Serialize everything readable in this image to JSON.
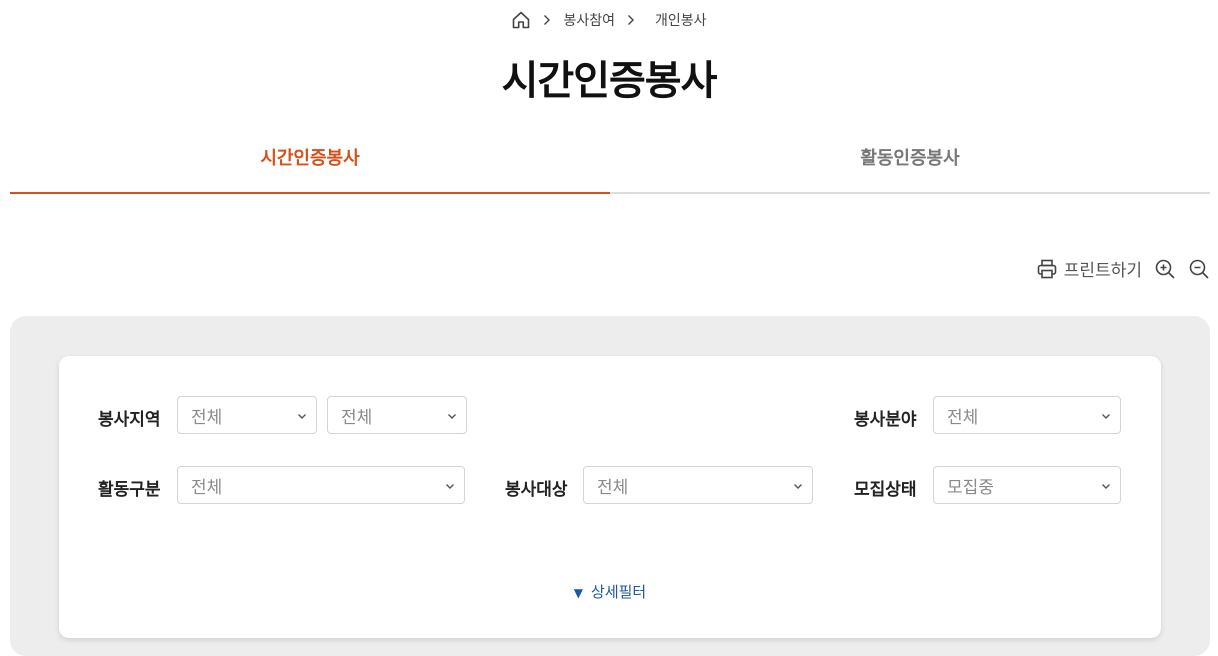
{
  "breadcrumb": {
    "items": [
      "봉사참여",
      "개인봉사"
    ]
  },
  "page_title": "시간인증봉사",
  "tabs": [
    {
      "label": "시간인증봉사",
      "active": true
    },
    {
      "label": "활동인증봉사",
      "active": false
    }
  ],
  "tools": {
    "print_label": "프린트하기"
  },
  "filters": {
    "region": {
      "label": "봉사지역",
      "value1": "전체",
      "value2": "전체"
    },
    "field": {
      "label": "봉사분야",
      "value": "전체"
    },
    "activity_type": {
      "label": "활동구분",
      "value": "전체"
    },
    "target": {
      "label": "봉사대상",
      "value": "전체"
    },
    "recruit_status": {
      "label": "모집상태",
      "value": "모집중"
    }
  },
  "detail_filter": {
    "label": "상세필터",
    "icon": "▼"
  },
  "colors": {
    "accent": "#d4511a",
    "link": "#1b58a8",
    "filter_bg": "#ededed"
  },
  "icons": [
    "home-icon",
    "chevron-right-icon",
    "printer-icon",
    "zoom-in-icon",
    "zoom-out-icon",
    "chevron-down-icon"
  ]
}
